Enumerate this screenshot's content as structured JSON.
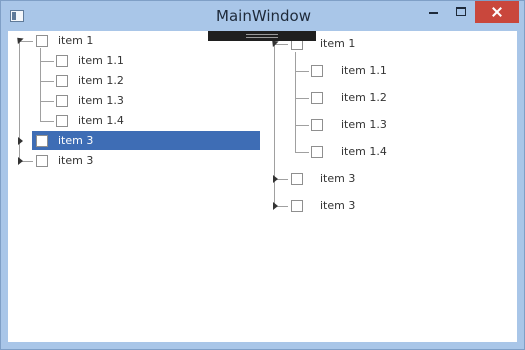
{
  "window": {
    "title": "MainWindow",
    "buttons": {
      "minimize": "minimize-icon",
      "maximize": "maximize-icon",
      "close": "close-icon"
    },
    "colors": {
      "frame": "#a9c6e8",
      "close": "#c9473c",
      "selection": "#3e6db5"
    }
  },
  "left_tree": {
    "items": [
      {
        "label": "item 1",
        "expanded": true,
        "children": [
          "item 1.1",
          "item 1.2",
          "item 1.3",
          "item 1.4"
        ]
      },
      {
        "label": "item 3",
        "expanded": false,
        "selected": true
      },
      {
        "label": "item 3",
        "expanded": false
      }
    ]
  },
  "right_tree": {
    "items": [
      {
        "label": "item 1",
        "expanded": true,
        "children": [
          "item 1.1",
          "item 1.2",
          "item 1.3",
          "item 1.4"
        ]
      },
      {
        "label": "item 3",
        "expanded": false
      },
      {
        "label": "item 3",
        "expanded": false
      }
    ]
  }
}
